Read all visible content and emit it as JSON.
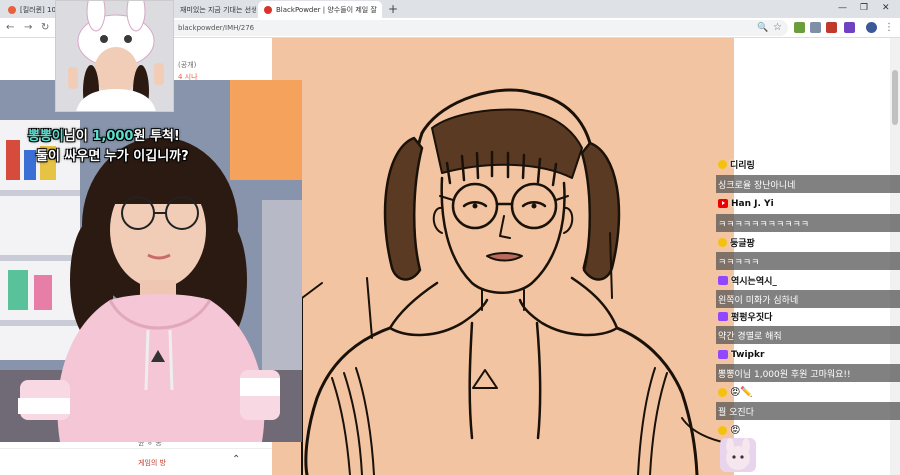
{
  "browser": {
    "tabs": [
      {
        "label": "[킬러퀸] 10",
        "favicon_color": "#e8613c"
      },
      {
        "label": "재미있는 지금 기대는 선생님 - Google 검",
        "favicon_color": "#4285f4"
      },
      {
        "label": "BlackPowder | 양수들이 제일 잘",
        "favicon_color": "#d9342b"
      }
    ],
    "url": "blackpowder/IMH/276"
  },
  "page": {
    "sidebar_texts": [
      "(공개)",
      "4 시나",
      "윤 ㅎ 공",
      "게임의 방"
    ]
  },
  "donation": {
    "donor": "뽕뽕이",
    "mid": "님이 ",
    "amount": "1,000",
    "after": "원 투척!",
    "question": "둘이 싸우면 누가 이깁니까?"
  },
  "chat": {
    "rows": [
      {
        "kind": "name",
        "badge": "star",
        "text": "디리링"
      },
      {
        "kind": "msg",
        "text": "싱크로율 장난아니네"
      },
      {
        "kind": "name",
        "badge": "yt",
        "text": "Han J. Yi"
      },
      {
        "kind": "msg",
        "text": "ㅋㅋㅋㅋㅋㅋㅋㅋㅋㅋㅋ"
      },
      {
        "kind": "name",
        "badge": "star",
        "text": "둥글팡"
      },
      {
        "kind": "msg",
        "text": "ㅋㅋㅋㅋㅋ"
      },
      {
        "kind": "name",
        "badge": "tw",
        "text": "역시는역시_"
      },
      {
        "kind": "msg",
        "text": "왼쪽이 미화가 심하네"
      },
      {
        "kind": "name",
        "badge": "tw",
        "text": "펑펑우짓다"
      },
      {
        "kind": "msg",
        "text": "약간 경멸로 해줘"
      },
      {
        "kind": "name",
        "badge": "tw",
        "text": "Twipkr"
      },
      {
        "kind": "msg",
        "text": "뽕뽕이님 1,000원 후원 고마워요!!"
      },
      {
        "kind": "name",
        "badge": "star",
        "text": "😡✏️"
      },
      {
        "kind": "msg",
        "text": "꿜 오진다"
      },
      {
        "kind": "name",
        "badge": "star",
        "text": "😡"
      }
    ]
  },
  "colors": {
    "canvas": "#f2c4a2",
    "hoodie": "#f4c6d6",
    "highlight": "#5be0d0"
  }
}
